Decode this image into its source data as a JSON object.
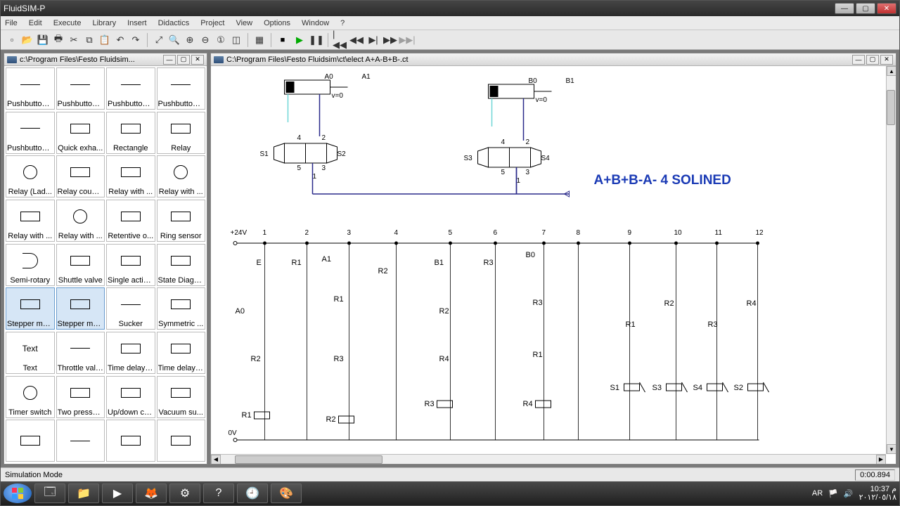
{
  "app": {
    "title": "FluidSIM-P"
  },
  "winbtns": {
    "min": "—",
    "max": "▢",
    "close": "✕"
  },
  "menu": [
    "File",
    "Edit",
    "Execute",
    "Library",
    "Insert",
    "Didactics",
    "Project",
    "View",
    "Options",
    "Window",
    "?"
  ],
  "toolbar": {
    "std": [
      "new-file-icon",
      "open-icon",
      "save-icon",
      "print-icon",
      "cut-icon",
      "copy-icon",
      "paste-icon",
      "undo-icon",
      "redo-icon"
    ],
    "zoom": [
      "zoom-fit-icon",
      "zoom-area-icon",
      "zoom-in-icon",
      "zoom-out-icon",
      "zoom-1-icon",
      "zoom-sel-icon"
    ],
    "sim": {
      "grid": "grid-icon",
      "stop": "■",
      "play": "▶",
      "pause": "❚❚",
      "first": "|◀◀",
      "back": "◀◀",
      "step": "▶|",
      "fwd": "▶▶",
      "last": "▶▶|"
    }
  },
  "leftPane": {
    "title": "c:\\Program Files\\Festo Fluidsim...",
    "items": [
      {
        "label": "Pushbutton ...",
        "g": "line"
      },
      {
        "label": "Pushbutton ...",
        "g": "line"
      },
      {
        "label": "Pushbutton ...",
        "g": "line"
      },
      {
        "label": "Pushbutton ...",
        "g": "line"
      },
      {
        "label": "Pushbutton ...",
        "g": "line"
      },
      {
        "label": "Quick exha...",
        "g": "box"
      },
      {
        "label": "Rectangle",
        "g": "box"
      },
      {
        "label": "Relay",
        "g": "box"
      },
      {
        "label": "Relay (Lad...",
        "g": "circ"
      },
      {
        "label": "Relay counter",
        "g": "box"
      },
      {
        "label": "Relay with ...",
        "g": "box"
      },
      {
        "label": "Relay with ...",
        "g": "circ"
      },
      {
        "label": "Relay with ...",
        "g": "box"
      },
      {
        "label": "Relay with ...",
        "g": "circ"
      },
      {
        "label": "Retentive o...",
        "g": "box"
      },
      {
        "label": "Ring sensor",
        "g": "box"
      },
      {
        "label": "Semi-rotary",
        "g": "half"
      },
      {
        "label": "Shuttle valve",
        "g": "box"
      },
      {
        "label": "Single actin...",
        "g": "box"
      },
      {
        "label": "State Diagram",
        "g": "box"
      },
      {
        "label": "Stepper mo...",
        "g": "box",
        "sel": true
      },
      {
        "label": "Stepper mo...",
        "g": "box",
        "sel": true
      },
      {
        "label": "Sucker",
        "g": "line"
      },
      {
        "label": "Symmetric ...",
        "g": "box"
      },
      {
        "label": "Text",
        "g": "text",
        "text": "Text"
      },
      {
        "label": "Throttle valve",
        "g": "line"
      },
      {
        "label": "Time delay ...",
        "g": "box"
      },
      {
        "label": "Time delay ...",
        "g": "box"
      },
      {
        "label": "Timer switch",
        "g": "circ"
      },
      {
        "label": "Two pressur...",
        "g": "box"
      },
      {
        "label": "Up/down co...",
        "g": "box"
      },
      {
        "label": "Vacuum su...",
        "g": "box"
      },
      {
        "label": "",
        "g": "box"
      },
      {
        "label": "",
        "g": "line"
      },
      {
        "label": "",
        "g": "box"
      },
      {
        "label": "",
        "g": "box"
      }
    ]
  },
  "rightPane": {
    "title": "C:\\Program Files\\Festo Fluidsim\\ct\\elect A+A-B+B-.ct"
  },
  "schematic": {
    "headline": "A+B+B-A- 4 SOLINED",
    "cylA": {
      "end0": "A0",
      "end1": "A1",
      "vel": "v=0",
      "ports": {
        "p4": "4",
        "p2": "2",
        "p5": "5",
        "p3": "3",
        "p1": "1"
      },
      "solL": "S1",
      "solR": "S2"
    },
    "cylB": {
      "end0": "B0",
      "end1": "B1",
      "vel": "v=0",
      "ports": {
        "p4": "4",
        "p2": "2",
        "p5": "5",
        "p3": "3",
        "p1": "1"
      },
      "solL": "S3",
      "solR": "S4"
    },
    "supply": "+24V",
    "ground": "0V",
    "rungNums": [
      "1",
      "2",
      "3",
      "4",
      "5",
      "6",
      "7",
      "8",
      "9",
      "10",
      "11",
      "12"
    ],
    "labels": {
      "E": "E",
      "A0": "A0",
      "A1": "A1",
      "B0": "B0",
      "B1": "B1",
      "R1": "R1",
      "R2": "R2",
      "R3": "R3",
      "R4": "R4",
      "S1": "S1",
      "S2": "S2",
      "S3": "S3",
      "S4": "S4"
    },
    "coils": {
      "R1": "R1",
      "R2": "R2",
      "R3": "R3",
      "R4": "R4"
    }
  },
  "status": {
    "mode": "Simulation Mode",
    "time": "0:00.894"
  },
  "taskbar": {
    "items": [
      "explorer-icon",
      "folder-icon",
      "media-player-icon",
      "firefox-icon",
      "fluidsim-icon",
      "help-icon",
      "clock-icon",
      "paint-icon"
    ],
    "lang": "AR",
    "clock": {
      "time": "10:37 م",
      "date": "٢٠١٢/٠٥/١٨"
    }
  }
}
